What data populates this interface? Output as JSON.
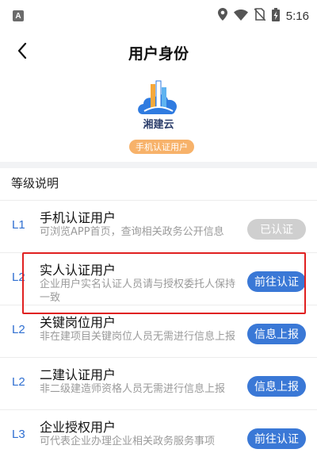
{
  "status_bar": {
    "app_badge": "A",
    "time": "5:16",
    "icons": [
      "location-icon",
      "wifi-icon",
      "no-sim-icon",
      "battery-charging-icon"
    ]
  },
  "header": {
    "title": "用户身份",
    "back_icon": "chevron-left-icon"
  },
  "profile": {
    "logo_text": "湘建云",
    "user_type": "手机认证用户"
  },
  "section": {
    "title": "等级说明"
  },
  "levels": [
    {
      "code": "L1",
      "name": "手机认证用户",
      "desc": "可浏览APP首页，查询相关政务公开信息",
      "button": "已认证",
      "state": "done"
    },
    {
      "code": "L2",
      "name": "实人认证用户",
      "desc": "企业用户实名认证人员请与授权委托人保持一致",
      "button": "前往认证",
      "state": "action"
    },
    {
      "code": "L2",
      "name": "关键岗位用户",
      "desc": "非在建项目关键岗位人员无需进行信息上报",
      "button": "信息上报",
      "state": "action"
    },
    {
      "code": "L2",
      "name": "二建认证用户",
      "desc": "非二级建造师资格人员无需进行信息上报",
      "button": "信息上报",
      "state": "action"
    },
    {
      "code": "L3",
      "name": "企业授权用户",
      "desc": "可代表企业办理企业相关政务服务事项",
      "button": "前往认证",
      "state": "action"
    }
  ],
  "colors": {
    "accent_blue": "#3a78d6",
    "level_code_blue": "#2f6fd1",
    "badge_orange": "#f7b26a",
    "disabled_gray": "#cfcfcf",
    "highlight_red": "#e02020"
  }
}
